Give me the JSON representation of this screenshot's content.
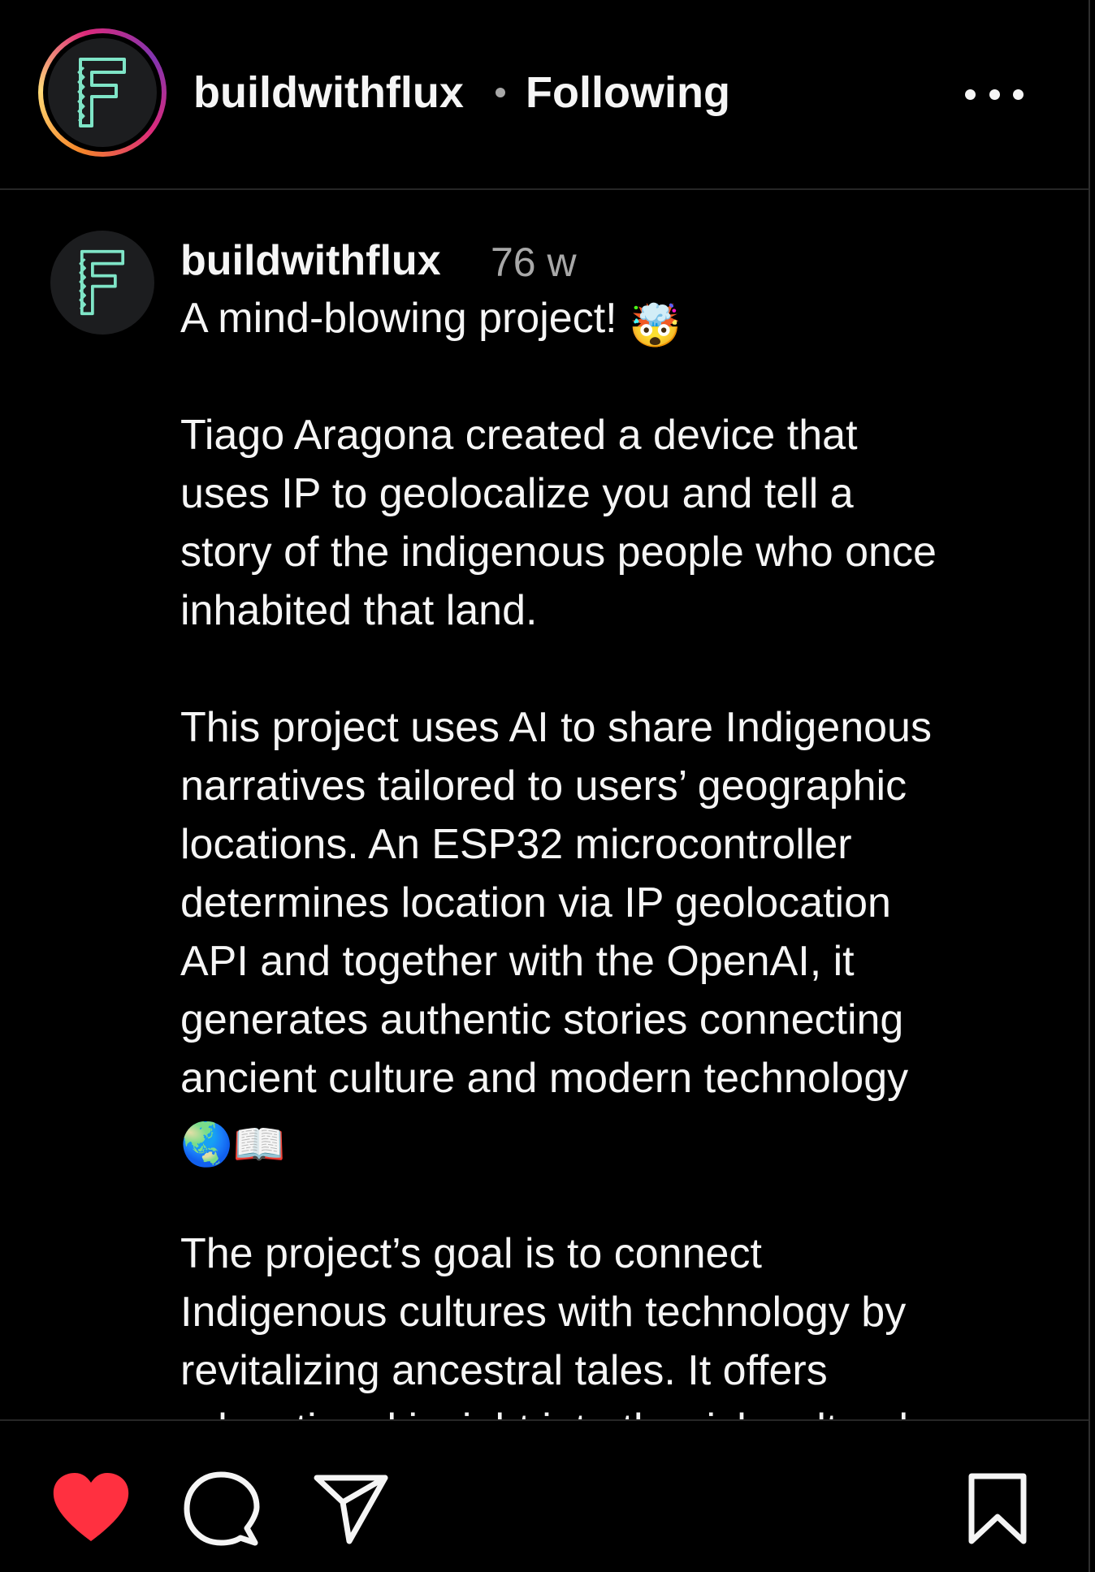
{
  "header": {
    "username": "buildwithflux",
    "separator": "•",
    "follow_status": "Following",
    "more_icon": "more-horizontal-icon",
    "avatar_letter": "F",
    "avatar_color": "#7fe5c7"
  },
  "caption": {
    "username": "buildwithflux",
    "time_ago": "76 w",
    "lines": [
      "A mind-blowing project!",
      "",
      "Tiago Aragona created a device that",
      "uses IP to geolocalize you and tell a",
      "story of the indigenous people who once",
      "inhabited that land.",
      "",
      "This project uses AI to share Indigenous",
      "narratives tailored to users’ geographic",
      "locations. An ESP32 microcontroller",
      "determines location via IP geolocation",
      "API and together with the OpenAI, it",
      "generates authentic stories connecting",
      "ancient culture and modern technology",
      "",
      "",
      "The project’s goal is to connect",
      "Indigenous cultures with technology by",
      "revitalizing ancestral tales. It offers",
      "educational insight into the rich cultural"
    ],
    "emoji_after_title": "🤯",
    "emoji_globe": "🌏",
    "emoji_book": "📖"
  },
  "actions": {
    "like_icon": "heart-filled-icon",
    "comment_icon": "comment-icon",
    "share_icon": "share-send-icon",
    "save_icon": "bookmark-icon",
    "like_color": "#ff3040"
  },
  "colors": {
    "background": "#000000",
    "text": "#f5f5f5",
    "muted": "#a8a8a8",
    "divider": "#262626"
  }
}
